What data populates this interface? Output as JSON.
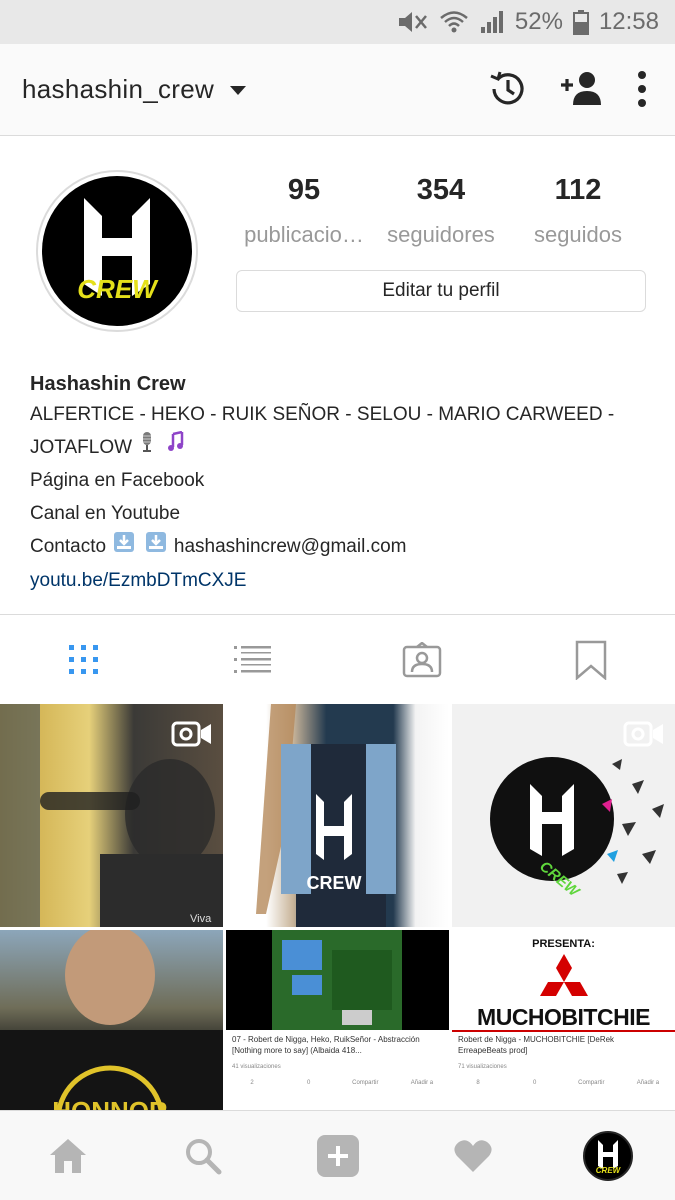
{
  "status_bar": {
    "battery_percent": "52%",
    "time": "12:58",
    "icons": [
      "mute-icon",
      "wifi-icon",
      "signal-icon",
      "battery-icon"
    ]
  },
  "header": {
    "username": "hashashin_crew",
    "icons": [
      "dropdown-caret-icon",
      "history-icon",
      "add-user-icon",
      "more-options-icon"
    ]
  },
  "profile": {
    "avatar_text": "CREW",
    "avatar_letter": "H",
    "stats": [
      {
        "value": "95",
        "label": "publicacio…"
      },
      {
        "value": "354",
        "label": "seguidores"
      },
      {
        "value": "112",
        "label": "seguidos"
      }
    ],
    "edit_button": "Editar tu perfil"
  },
  "bio": {
    "full_name": "Hashashin Crew",
    "line1": "ALFERTICE - HEKO - RUIK SEÑOR - SELOU - MARIO CARWEED -",
    "line2": "JOTAFLOW",
    "line3": "Página en Facebook",
    "line4": "Canal en Youtube",
    "contact_label": "Contacto",
    "email": "hashashincrew@gmail.com",
    "link": "youtu.be/EzmbDTmCXJE",
    "emojis": [
      "microphone-emoji",
      "music-notes-emoji",
      "inbox-tray-emoji",
      "inbox-tray-emoji"
    ]
  },
  "tabs": [
    "grid-view-icon",
    "list-view-icon",
    "tagged-photos-icon",
    "saved-icon"
  ],
  "accent_color": "#3897f0",
  "posts": [
    {
      "type": "video",
      "overlay_text": "Viva"
    },
    {
      "type": "photo",
      "shirt_text": "CREW"
    },
    {
      "type": "video",
      "logo_text": "CREW"
    },
    {
      "type": "photo",
      "shirt_text": "HONNOR"
    },
    {
      "type": "photo",
      "video_title": "07 - Robert de Nigga, Heko, RuikSeñor - Abstracción [Nothing more to say] (Albaida 418...",
      "views": "41 visualizaciones",
      "actions": [
        "2",
        "0",
        "Compartir",
        "Añadir a"
      ]
    },
    {
      "type": "photo",
      "presenta": "PRESENTA:",
      "headline": "MUCHOBITCHIE",
      "video_title": "Robert de Nigga - MUCHOBITCHIE [DeRek ErreapeBeats prod]",
      "views": "71 visualizaciones",
      "actions": [
        "8",
        "0",
        "Compartir",
        "Añadir a"
      ]
    }
  ],
  "bottom_nav": [
    "home-icon",
    "search-icon",
    "new-post-icon",
    "activity-icon",
    "profile-avatar"
  ]
}
